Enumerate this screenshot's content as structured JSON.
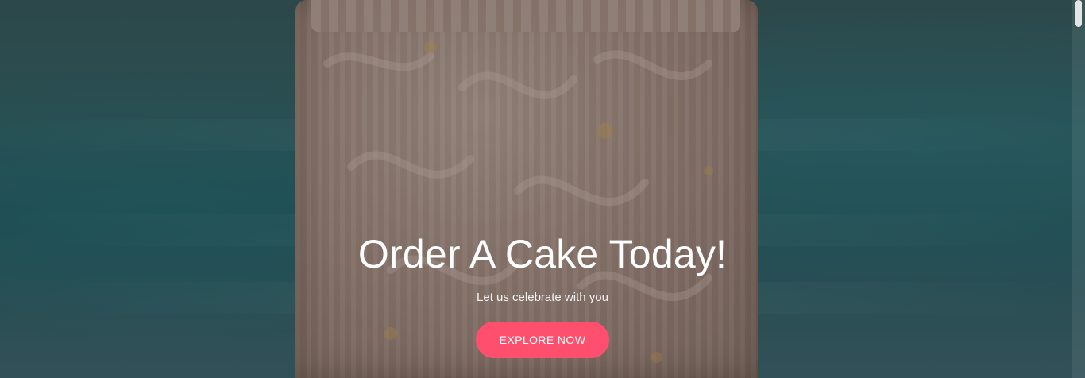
{
  "hero": {
    "title": "Order A Cake Today!",
    "subtitle": "Let us celebrate with you",
    "cta_label": "EXPLORE NOW"
  },
  "colors": {
    "cta_background": "#ff4f6e",
    "overlay_tint": "#000000"
  },
  "icons": {
    "scrollbar_thumb": "scrollbar-thumb"
  }
}
